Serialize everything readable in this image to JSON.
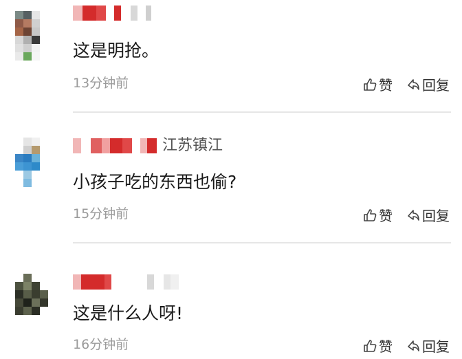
{
  "comments": [
    {
      "text": "这是明抢。",
      "time": "13分钟前",
      "location": "",
      "like_label": "赞",
      "reply_label": "回复"
    },
    {
      "text": "小孩子吃的东西也偷?",
      "time": "15分钟前",
      "location": "江苏镇江",
      "like_label": "赞",
      "reply_label": "回复"
    },
    {
      "text": "这是什么人呀!",
      "time": "16分钟前",
      "location": "",
      "like_label": "赞",
      "reply_label": "回复"
    }
  ],
  "colors": {
    "censor_red": "#d42b2b",
    "censor_pink": "#f1b6b6",
    "censor_grey": "#d8d8d8",
    "divider": "#e6e6e6",
    "time_text": "#9a9a9a"
  }
}
